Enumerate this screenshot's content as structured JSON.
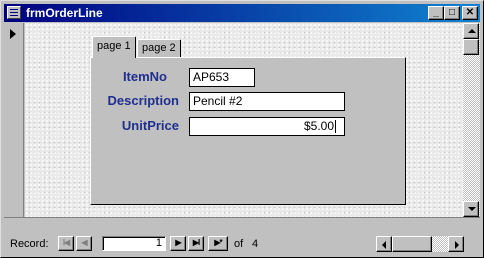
{
  "window": {
    "title": "frmOrderLine",
    "minimize_glyph": "_",
    "maximize_glyph": "□",
    "close_glyph": "✕"
  },
  "tabs": [
    {
      "label": "page 1",
      "active": true
    },
    {
      "label": "page 2",
      "active": false
    }
  ],
  "fields": {
    "item_no": {
      "label": "ItemNo",
      "value": "AP653"
    },
    "description": {
      "label": "Description",
      "value": "Pencil #2"
    },
    "unit_price": {
      "label": "UnitPrice",
      "value": "$5.00"
    }
  },
  "navigation": {
    "record_label": "Record:",
    "current_record": "1",
    "of_label": "of",
    "total_records": "4",
    "first_glyph": "I◀",
    "prev_glyph": "◀",
    "next_glyph": "▶",
    "last_glyph": "▶I",
    "new_glyph": "▶*"
  },
  "icons": {
    "record_selector": "current-record-arrow-icon",
    "window_menu": "form-icon"
  },
  "colors": {
    "title_bar": "#000080",
    "field_label": "#1f2f8f",
    "face": "#c0c0c0"
  }
}
